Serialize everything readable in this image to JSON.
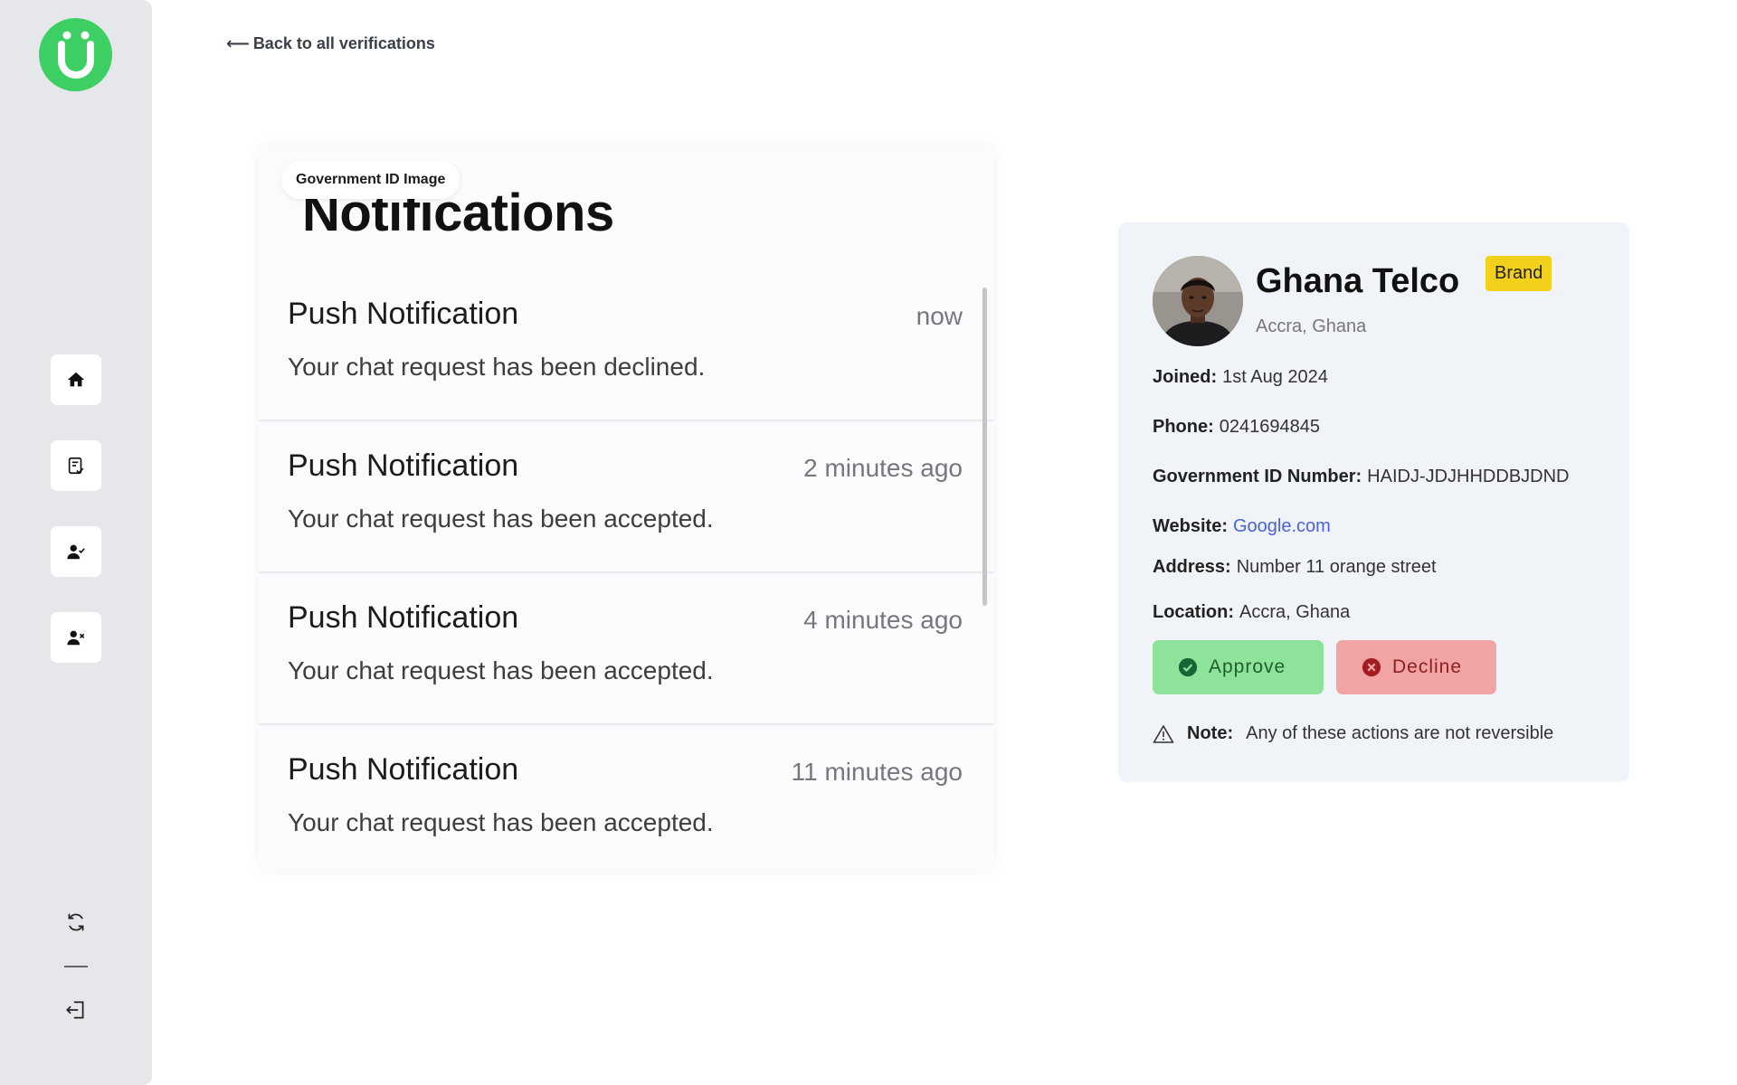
{
  "back_link": {
    "arrow": "⟵",
    "label": "Back to all verifications"
  },
  "sidebar": {
    "nav": [
      {
        "icon": "home-icon"
      },
      {
        "icon": "document-check-icon"
      },
      {
        "icon": "user-check-icon"
      },
      {
        "icon": "user-remove-icon"
      }
    ],
    "bottom": [
      {
        "icon": "refresh-icon"
      },
      {
        "icon": "logout-icon"
      }
    ]
  },
  "id_image": {
    "label": "Government ID Image",
    "screenshot": {
      "title": "Notifications",
      "items": [
        {
          "title": "Push Notification",
          "time": "now",
          "body": "Your chat request has been declined."
        },
        {
          "title": "Push Notification",
          "time": "2 minutes ago",
          "body": "Your chat request has been accepted."
        },
        {
          "title": "Push Notification",
          "time": "4 minutes ago",
          "body": "Your chat request has been accepted."
        },
        {
          "title": "Push Notification",
          "time": "11 minutes ago",
          "body": "Your chat request has been accepted."
        }
      ]
    }
  },
  "profile": {
    "name": "Ghana Telco",
    "badge": "Brand",
    "location": "Accra, Ghana",
    "fields": {
      "joined": {
        "label": "Joined:",
        "value": "1st Aug 2024"
      },
      "phone": {
        "label": "Phone:",
        "value": "0241694845"
      },
      "gov_id": {
        "label": "Government ID Number:",
        "value": "HAIDJ-JDJHHDDBJDND"
      },
      "website": {
        "label": "Website:",
        "value": "Google.com"
      },
      "address": {
        "label": "Address:",
        "value": "Number 11 orange street"
      },
      "location": {
        "label": "Location:",
        "value": "Accra, Ghana"
      }
    }
  },
  "actions": {
    "approve": "Approve",
    "decline": "Decline"
  },
  "note": {
    "label": "Note:",
    "text": "Any of these actions are not reversible"
  },
  "colors": {
    "logo": "#3ecf64",
    "approve_bg": "#8ee39a",
    "decline_bg": "#f2a3a3",
    "badge": "#f2d01c",
    "link": "#4a62d8"
  }
}
